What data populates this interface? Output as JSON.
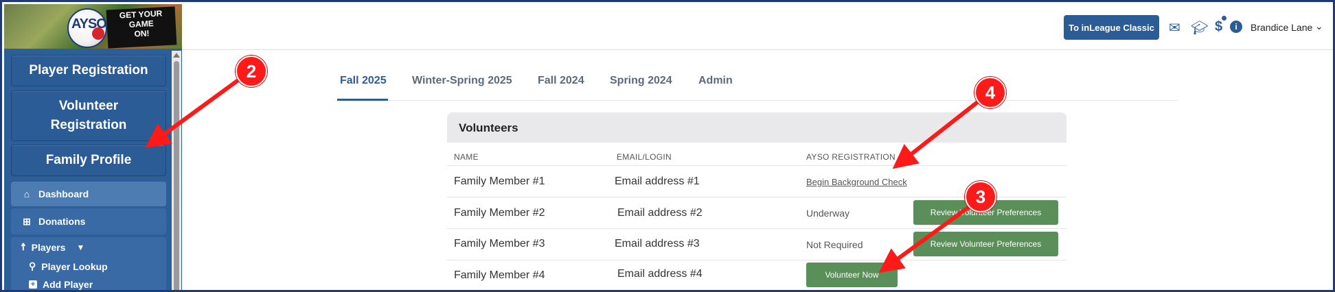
{
  "logo": {
    "ayso_text": "AYSO",
    "slogan": [
      "GET YOUR",
      "GAME",
      "ON!"
    ]
  },
  "sidebar": {
    "player_registration": "Player Registration",
    "volunteer_registration": "Volunteer Registration",
    "family_profile": "Family Profile",
    "dashboard": "Dashboard",
    "donations": "Donations",
    "players": "Players",
    "player_lookup": "Player Lookup",
    "add_player": "Add Player",
    "icons": {
      "dashboard": "home-icon",
      "donations": "gift-icon",
      "players": "person-icon",
      "player_lookup": "search-icon",
      "add_player": "plus-square-icon"
    }
  },
  "topbar": {
    "classic_button": "To inLeague Classic",
    "user_name": "Brandice Lane",
    "icons": [
      "mail-icon",
      "graduation-cap-icon",
      "dollar-icon",
      "info-icon"
    ]
  },
  "tabs": [
    {
      "label": "Fall 2025",
      "active": true
    },
    {
      "label": "Winter-Spring 2025",
      "active": false
    },
    {
      "label": "Fall 2024",
      "active": false
    },
    {
      "label": "Spring 2024",
      "active": false
    },
    {
      "label": "Admin",
      "active": false
    }
  ],
  "volunteers": {
    "title": "Volunteers",
    "columns": [
      "NAME",
      "EMAIL/LOGIN",
      "AYSO REGISTRATION"
    ],
    "rows": [
      {
        "name": "Family Member #1",
        "email": "Email address #1",
        "status": "Begin Background Check",
        "action": ""
      },
      {
        "name": "Family Member #2",
        "email": "Email address #2",
        "status": "Underway",
        "action": "Review Volunteer Preferences"
      },
      {
        "name": "Family Member #3",
        "email": "Email address #3",
        "status": "Not Required",
        "action": "Review Volunteer Preferences"
      },
      {
        "name": "Family Member #4",
        "email": "Email address #4",
        "status": "",
        "action": "Volunteer Now"
      }
    ]
  },
  "annotations": [
    "2",
    "3",
    "4"
  ],
  "colors": {
    "primary": "#2b5c96",
    "annotation": "#ff1a1a",
    "action_button": "#5a8f5a"
  }
}
